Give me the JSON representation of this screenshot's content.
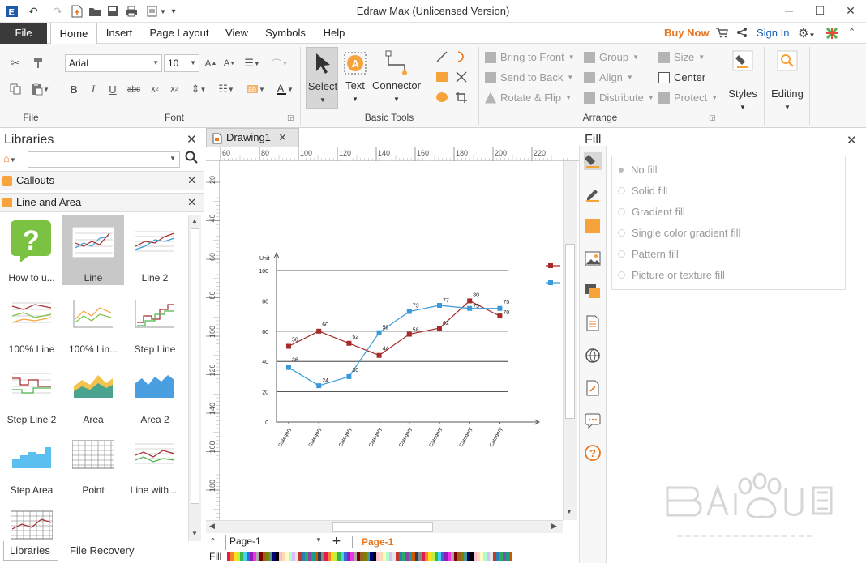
{
  "window": {
    "title": "Edraw Max (Unlicensed Version)"
  },
  "menu": {
    "file": "File",
    "tabs": [
      "Home",
      "Insert",
      "Page Layout",
      "View",
      "Symbols",
      "Help"
    ],
    "buy_now": "Buy Now",
    "sign_in": "Sign In"
  },
  "ribbon": {
    "file_group": "File",
    "font_group": "Font",
    "font_name": "Arial",
    "font_size": "10",
    "basic_tools_group": "Basic Tools",
    "select": "Select",
    "text": "Text",
    "connector": "Connector",
    "arrange_group": "Arrange",
    "bring_to_front": "Bring to Front",
    "send_to_back": "Send to Back",
    "rotate_flip": "Rotate & Flip",
    "group": "Group",
    "align": "Align",
    "distribute": "Distribute",
    "size": "Size",
    "center": "Center",
    "protect": "Protect",
    "styles": "Styles",
    "editing": "Editing"
  },
  "libraries": {
    "title": "Libraries",
    "categories": [
      "Callouts",
      "Line and Area"
    ],
    "shapes": [
      "How to u...",
      "Line",
      "Line 2",
      "100% Line",
      "100% Lin...",
      "Step Line",
      "Step Line 2",
      "Area",
      "Area 2",
      "Step Area",
      "Point",
      "Line with ..."
    ],
    "bottom_tabs": [
      "Libraries",
      "File Recovery"
    ]
  },
  "document": {
    "tab": "Drawing1",
    "ruler_h": [
      "60",
      "80",
      "100",
      "120",
      "140",
      "160",
      "180",
      "200",
      "220"
    ],
    "ruler_v": [
      "20",
      "40",
      "60",
      "80",
      "100",
      "120",
      "140",
      "160",
      "180"
    ],
    "page_selector": "Page-1",
    "page_tab": "Page-1",
    "fill_label": "Fill"
  },
  "chart_data": {
    "type": "line",
    "ylabel": "Unit",
    "ylim": [
      0,
      100
    ],
    "yticks": [
      "0",
      "20",
      "40",
      "60",
      "80",
      "100"
    ],
    "categories": [
      "Category",
      "Category",
      "Category",
      "Category",
      "Category",
      "Category",
      "Category",
      "Category"
    ],
    "series": [
      {
        "values": [
          50,
          60,
          52,
          44,
          58,
          62,
          80,
          70
        ],
        "color": "#a52a2a"
      },
      {
        "values": [
          36,
          24,
          30,
          59,
          73,
          77,
          75,
          75
        ],
        "color": "#3a9ad9"
      }
    ]
  },
  "fill_panel": {
    "title": "Fill",
    "options": [
      "No fill",
      "Solid fill",
      "Gradient fill",
      "Single color gradient fill",
      "Pattern fill",
      "Picture or texture fill"
    ]
  },
  "palette": [
    "#e6194b",
    "#f58231",
    "#ffe119",
    "#bfef45",
    "#3cb44b",
    "#42d4f4",
    "#4363d8",
    "#911eb4",
    "#f032e6",
    "#a9a9a9",
    "#800000",
    "#9a6324",
    "#808000",
    "#469990",
    "#000075",
    "#000000",
    "#fabed4",
    "#ffd8b1",
    "#fffac8",
    "#aaffc3",
    "#dcbeff",
    "#e6e6e6",
    "#c0392b",
    "#2980b9",
    "#27ae60",
    "#8e44ad",
    "#16a085",
    "#d35400",
    "#2c3e50",
    "#7f8c8d"
  ]
}
